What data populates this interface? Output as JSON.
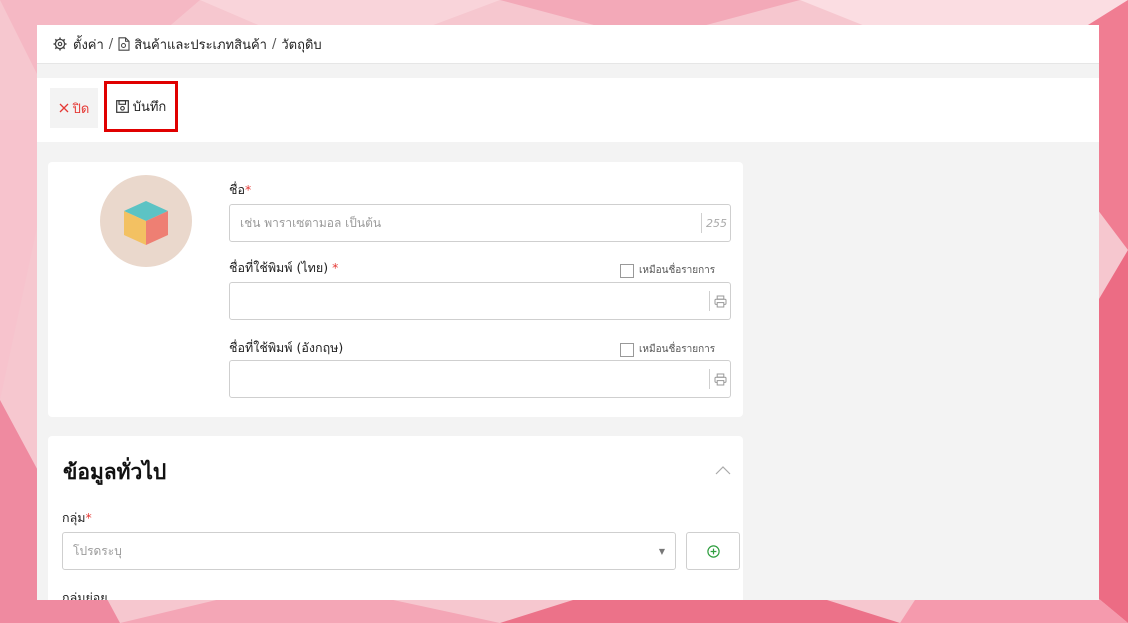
{
  "breadcrumb": {
    "settings_label": "ตั้งค่า",
    "products_label": "สินค้าและประเภทสินค้า",
    "current_label": "วัตถุดิบ",
    "separator": "/"
  },
  "toolbar": {
    "close_label": "ปิด",
    "save_label": "บันทึก"
  },
  "form": {
    "name_label": "ชื่อ",
    "name_placeholder": "เช่น พาราเซตามอล เป็นต้น",
    "name_maxlength": "255",
    "print_th_label": "ชื่อที่ใช้พิมพ์ (ไทย)",
    "print_th_value": "",
    "print_en_label": "ชื่อที่ใช้พิมพ์ (อังกฤษ)",
    "print_en_value": "",
    "same_as_item_label": "เหมือนชื่อรายการ",
    "required_mark": "*"
  },
  "general": {
    "title": "ข้อมูลทั่วไป",
    "group_label": "กลุ่ม",
    "group_placeholder": "โปรดระบุ",
    "subgroup_label": "กลุ่มย่อย"
  },
  "colors": {
    "accent_red": "#e53935",
    "highlight_border": "#e00000",
    "add_icon_green": "#2e9e3e"
  },
  "icons": {
    "settings": "gear-icon",
    "document": "document-icon",
    "close": "close-icon",
    "save": "floppy-icon",
    "printer": "printer-icon",
    "collapse": "chevron-up-icon",
    "add": "plus-circle-icon",
    "dropdown": "caret-down-icon"
  }
}
